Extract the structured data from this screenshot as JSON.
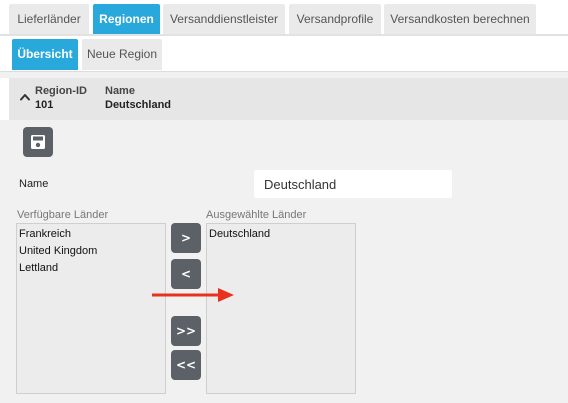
{
  "tabs": [
    {
      "label": "Lieferländer",
      "active": false
    },
    {
      "label": "Regionen",
      "active": true
    },
    {
      "label": "Versanddienstleister",
      "active": false
    },
    {
      "label": "Versandprofile",
      "active": false
    },
    {
      "label": "Versandkosten berechnen",
      "active": false
    }
  ],
  "subtabs": [
    {
      "label": "Übersicht",
      "active": true
    },
    {
      "label": "Neue Region",
      "active": false
    }
  ],
  "region": {
    "id_label": "Region-ID",
    "id_value": "101",
    "name_label": "Name",
    "name_value": "Deutschland"
  },
  "form": {
    "name_label": "Name",
    "name_value": "Deutschland",
    "available_label": "Verfügbare Länder",
    "available_countries": [
      "Frankreich",
      "United Kingdom",
      "Lettland"
    ],
    "selected_label": "Ausgewählte Länder",
    "selected_countries": [
      "Deutschland"
    ],
    "move_right": ">",
    "move_left": "<",
    "move_all_right": ">>",
    "move_all_left": "<<"
  },
  "colors": {
    "accent": "#29a8dc",
    "button": "#5b6167",
    "annotation_arrow": "#e8321f"
  },
  "icons": {
    "collapse": "chevron-up-icon",
    "save": "save-icon",
    "annotation": "red-arrow-right-icon"
  }
}
